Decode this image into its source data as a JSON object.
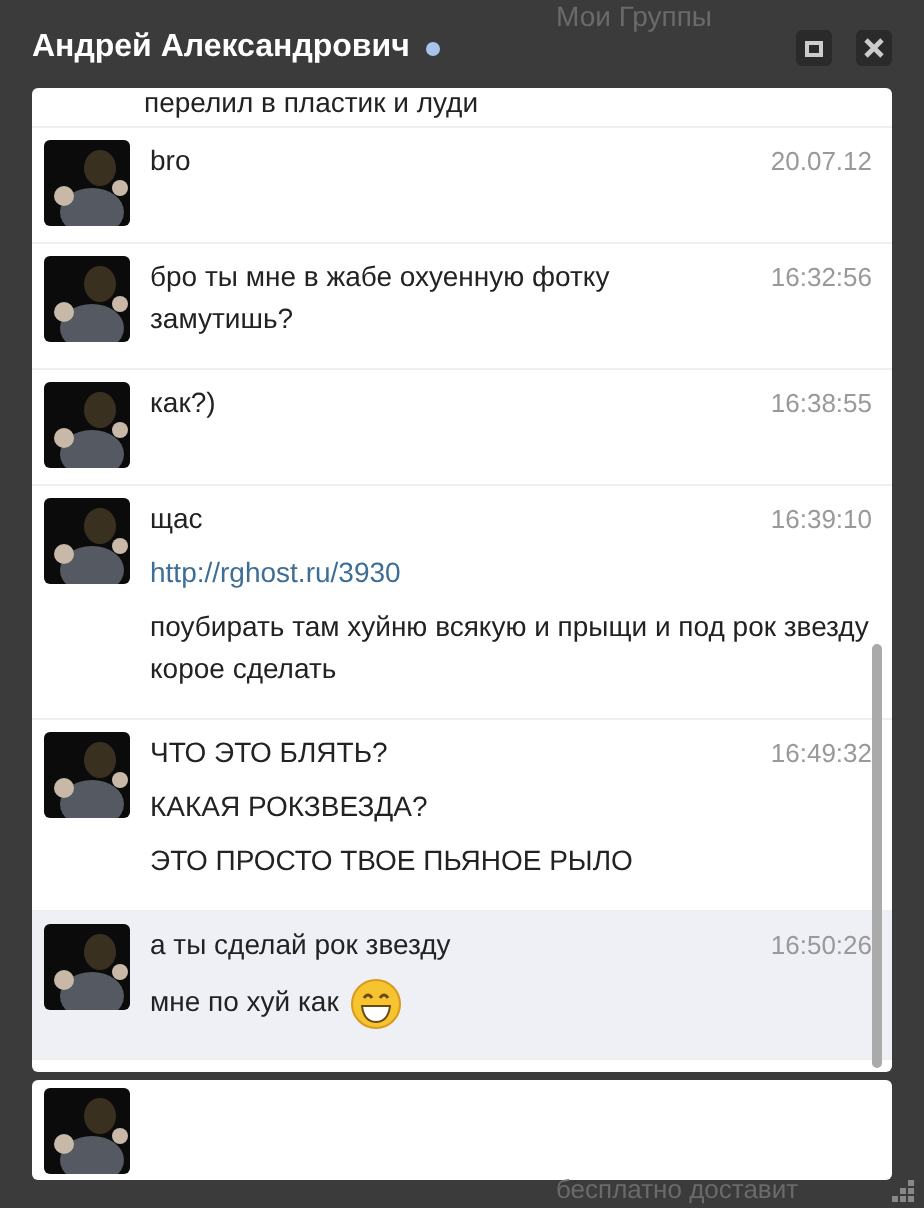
{
  "window": {
    "title": "Андрей Александрович",
    "online": true
  },
  "background_page": {
    "top_link": "Мои Группы",
    "bottom_text": "бесплатно доставит"
  },
  "cut_line": "перелил в пластик и луди",
  "messages": [
    {
      "time": "20.07.12",
      "highlighted": false,
      "lines": [
        {
          "kind": "text",
          "text": "bro"
        }
      ]
    },
    {
      "time": "16:32:56",
      "highlighted": false,
      "lines": [
        {
          "kind": "text",
          "text": "бро ты мне в жабе охуенную фотку замутишь?"
        }
      ]
    },
    {
      "time": "16:38:55",
      "highlighted": false,
      "lines": [
        {
          "kind": "text",
          "text": "как?)"
        }
      ]
    },
    {
      "time": "16:39:10",
      "highlighted": false,
      "lines": [
        {
          "kind": "text",
          "text": "щас"
        },
        {
          "kind": "link",
          "text": "http://rghost.ru/3930"
        },
        {
          "kind": "text",
          "text": "поубирать там хуйню всякую и прыщи и под рок звезду корое сделать"
        }
      ]
    },
    {
      "time": "16:49:32",
      "highlighted": false,
      "lines": [
        {
          "kind": "text",
          "text": "ЧТО ЭТО БЛЯТЬ?"
        },
        {
          "kind": "text",
          "text": "КАКАЯ РОКЗВЕЗДА?"
        },
        {
          "kind": "text",
          "text": "ЭТО ПРОСТО ТВОЕ ПЬЯНОЕ РЫЛО"
        }
      ]
    },
    {
      "time": "16:50:26",
      "highlighted": true,
      "lines": [
        {
          "kind": "text",
          "text": "а ты сделай рок звезду"
        },
        {
          "kind": "text",
          "text": "мне по хуй как",
          "emoji": true
        }
      ]
    }
  ]
}
